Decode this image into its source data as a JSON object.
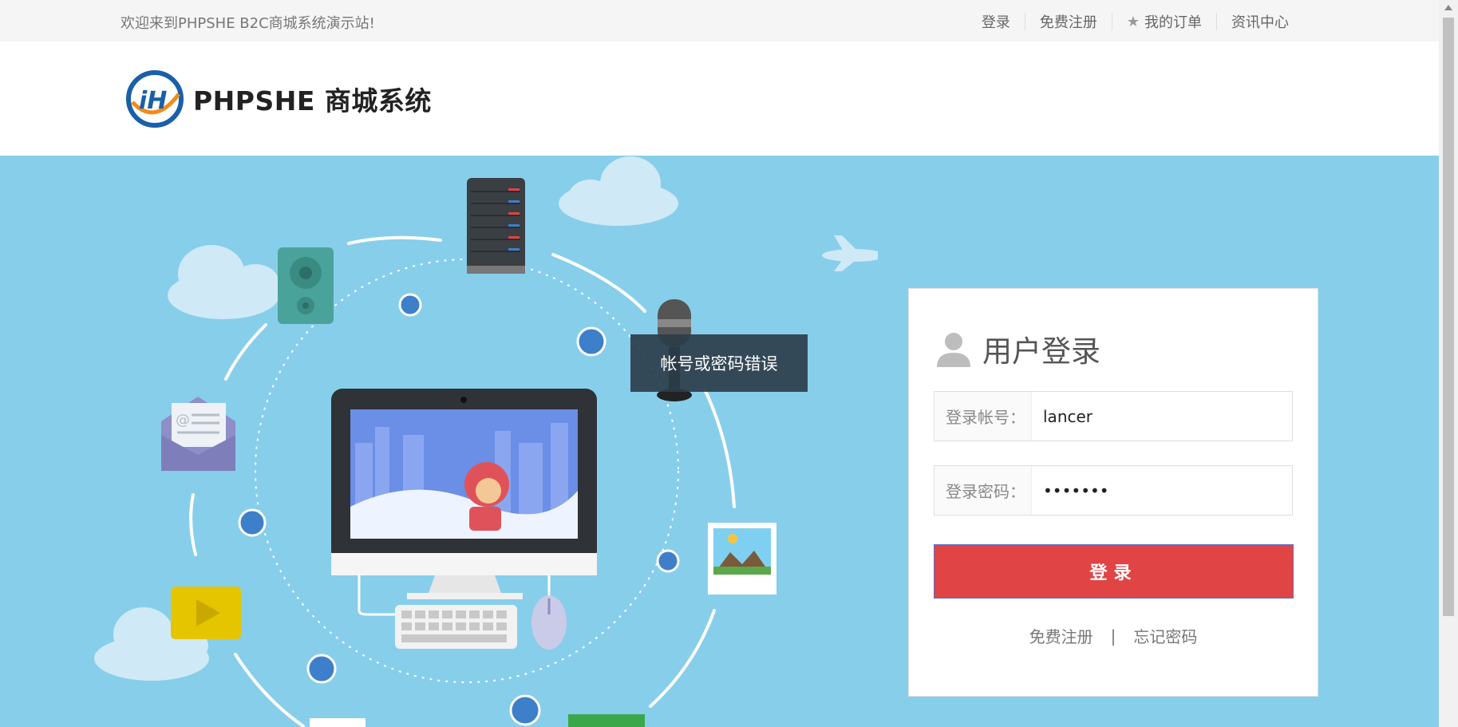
{
  "topbar": {
    "welcome": "欢迎来到PHPSHE B2C商城系统演示站!",
    "links": [
      {
        "label": "登录"
      },
      {
        "label": "免费注册"
      },
      {
        "label": "我的订单",
        "icon": "star-icon"
      },
      {
        "label": "资讯中心"
      }
    ]
  },
  "header": {
    "logo_text": "PHPSHE 商城系统"
  },
  "toast": {
    "message": "帐号或密码错误"
  },
  "login": {
    "title": "用户登录",
    "account_label": "登录帐号：",
    "account_value": "lancer",
    "password_label": "登录密码：",
    "password_value": "lancer1",
    "submit_label": "登录",
    "register_link": "免费注册",
    "separator": "|",
    "forgot_link": "忘记密码"
  },
  "colors": {
    "banner_bg": "#87ceeb",
    "login_button": "#e04444",
    "toast_bg": "#2d3e4a"
  }
}
